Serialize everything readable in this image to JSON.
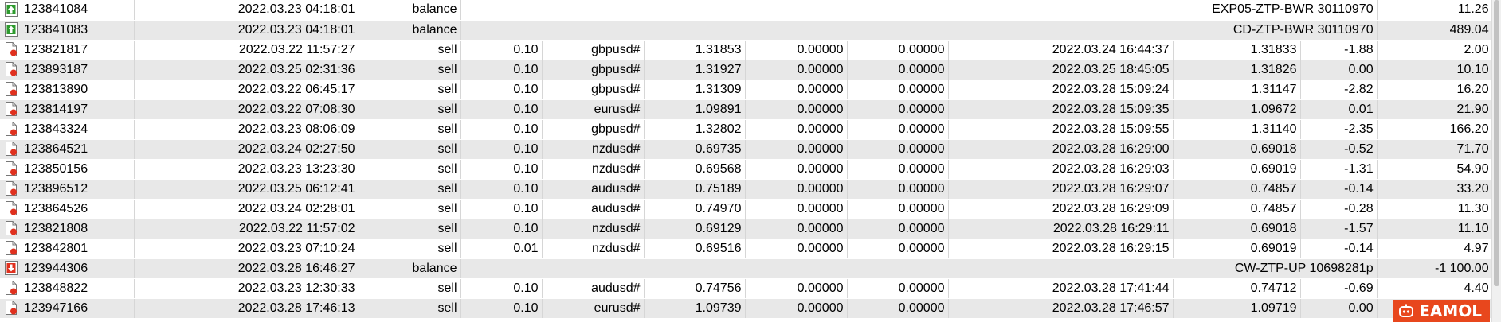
{
  "rows": [
    {
      "type": "balance",
      "ticket": "123841084",
      "open_time": "2022.03.23 04:18:01",
      "action": "balance",
      "comment": "EXP05-ZTP-BWR 30110970",
      "amount": "11.26"
    },
    {
      "type": "balance",
      "ticket": "123841083",
      "open_time": "2022.03.23 04:18:01",
      "action": "balance",
      "comment": "CD-ZTP-BWR 30110970",
      "amount": "489.04"
    },
    {
      "type": "trade",
      "ticket": "123821817",
      "open_time": "2022.03.22 11:57:27",
      "action": "sell",
      "size": "0.10",
      "symbol": "gbpusd#",
      "price": "1.31853",
      "sl": "0.00000",
      "tp": "0.00000",
      "close_time": "2022.03.24 16:44:37",
      "close_price": "1.31833",
      "swap": "-1.88",
      "profit": "2.00"
    },
    {
      "type": "trade",
      "ticket": "123893187",
      "open_time": "2022.03.25 02:31:36",
      "action": "sell",
      "size": "0.10",
      "symbol": "gbpusd#",
      "price": "1.31927",
      "sl": "0.00000",
      "tp": "0.00000",
      "close_time": "2022.03.25 18:45:05",
      "close_price": "1.31826",
      "swap": "0.00",
      "profit": "10.10"
    },
    {
      "type": "trade",
      "ticket": "123813890",
      "open_time": "2022.03.22 06:45:17",
      "action": "sell",
      "size": "0.10",
      "symbol": "gbpusd#",
      "price": "1.31309",
      "sl": "0.00000",
      "tp": "0.00000",
      "close_time": "2022.03.28 15:09:24",
      "close_price": "1.31147",
      "swap": "-2.82",
      "profit": "16.20"
    },
    {
      "type": "trade",
      "ticket": "123814197",
      "open_time": "2022.03.22 07:08:30",
      "action": "sell",
      "size": "0.10",
      "symbol": "eurusd#",
      "price": "1.09891",
      "sl": "0.00000",
      "tp": "0.00000",
      "close_time": "2022.03.28 15:09:35",
      "close_price": "1.09672",
      "swap": "0.01",
      "profit": "21.90"
    },
    {
      "type": "trade",
      "ticket": "123843324",
      "open_time": "2022.03.23 08:06:09",
      "action": "sell",
      "size": "0.10",
      "symbol": "gbpusd#",
      "price": "1.32802",
      "sl": "0.00000",
      "tp": "0.00000",
      "close_time": "2022.03.28 15:09:55",
      "close_price": "1.31140",
      "swap": "-2.35",
      "profit": "166.20"
    },
    {
      "type": "trade",
      "ticket": "123864521",
      "open_time": "2022.03.24 02:27:50",
      "action": "sell",
      "size": "0.10",
      "symbol": "nzdusd#",
      "price": "0.69735",
      "sl": "0.00000",
      "tp": "0.00000",
      "close_time": "2022.03.28 16:29:00",
      "close_price": "0.69018",
      "swap": "-0.52",
      "profit": "71.70"
    },
    {
      "type": "trade",
      "ticket": "123850156",
      "open_time": "2022.03.23 13:23:30",
      "action": "sell",
      "size": "0.10",
      "symbol": "nzdusd#",
      "price": "0.69568",
      "sl": "0.00000",
      "tp": "0.00000",
      "close_time": "2022.03.28 16:29:03",
      "close_price": "0.69019",
      "swap": "-1.31",
      "profit": "54.90"
    },
    {
      "type": "trade",
      "ticket": "123896512",
      "open_time": "2022.03.25 06:12:41",
      "action": "sell",
      "size": "0.10",
      "symbol": "audusd#",
      "price": "0.75189",
      "sl": "0.00000",
      "tp": "0.00000",
      "close_time": "2022.03.28 16:29:07",
      "close_price": "0.74857",
      "swap": "-0.14",
      "profit": "33.20"
    },
    {
      "type": "trade",
      "ticket": "123864526",
      "open_time": "2022.03.24 02:28:01",
      "action": "sell",
      "size": "0.10",
      "symbol": "audusd#",
      "price": "0.74970",
      "sl": "0.00000",
      "tp": "0.00000",
      "close_time": "2022.03.28 16:29:09",
      "close_price": "0.74857",
      "swap": "-0.28",
      "profit": "11.30"
    },
    {
      "type": "trade",
      "ticket": "123821808",
      "open_time": "2022.03.22 11:57:02",
      "action": "sell",
      "size": "0.10",
      "symbol": "nzdusd#",
      "price": "0.69129",
      "sl": "0.00000",
      "tp": "0.00000",
      "close_time": "2022.03.28 16:29:11",
      "close_price": "0.69018",
      "swap": "-1.57",
      "profit": "11.10"
    },
    {
      "type": "trade",
      "ticket": "123842801",
      "open_time": "2022.03.23 07:10:24",
      "action": "sell",
      "size": "0.01",
      "symbol": "nzdusd#",
      "price": "0.69516",
      "sl": "0.00000",
      "tp": "0.00000",
      "close_time": "2022.03.28 16:29:15",
      "close_price": "0.69019",
      "swap": "-0.14",
      "profit": "4.97"
    },
    {
      "type": "balance-out",
      "ticket": "123944306",
      "open_time": "2022.03.28 16:46:27",
      "action": "balance",
      "comment": "CW-ZTP-UP 10698281p",
      "amount": "-1 100.00"
    },
    {
      "type": "trade",
      "ticket": "123848822",
      "open_time": "2022.03.23 12:30:33",
      "action": "sell",
      "size": "0.10",
      "symbol": "audusd#",
      "price": "0.74756",
      "sl": "0.00000",
      "tp": "0.00000",
      "close_time": "2022.03.28 17:41:44",
      "close_price": "0.74712",
      "swap": "-0.69",
      "profit": "4.40"
    },
    {
      "type": "trade",
      "ticket": "123947166",
      "open_time": "2022.03.28 17:46:13",
      "action": "sell",
      "size": "0.10",
      "symbol": "eurusd#",
      "price": "1.09739",
      "sl": "0.00000",
      "tp": "0.00000",
      "close_time": "2022.03.28 17:46:57",
      "close_price": "1.09719",
      "swap": "0.00",
      "profit": ""
    }
  ],
  "icons": {
    "balance": "balance-deposit-icon",
    "balance-out": "balance-withdraw-icon",
    "trade": "sell-order-icon"
  },
  "colors": {
    "row_alt": "#e8e8e8",
    "deposit_icon": "#2e9a2e",
    "order_icon": "#e0301e"
  },
  "watermark": {
    "text": "EAMOL"
  }
}
